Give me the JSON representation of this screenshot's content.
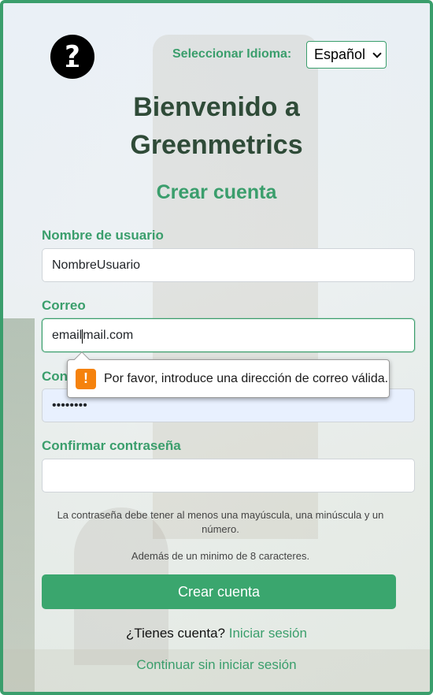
{
  "language": {
    "label": "Seleccionar Idioma:",
    "selected": "Español"
  },
  "header": {
    "title_line1": "Bienvenido a",
    "title_line2": "Greenmetrics",
    "subtitle": "Crear cuenta"
  },
  "form": {
    "username": {
      "label": "Nombre de usuario",
      "value": "NombreUsuario"
    },
    "email": {
      "label": "Correo",
      "value_before_caret": "email",
      "value_after_caret": "mail.com"
    },
    "password": {
      "label": "Con",
      "value": "••••••••"
    },
    "confirm": {
      "label": "Confirmar contraseña",
      "value": ""
    },
    "validation_message": "Por favor, introduce una dirección de correo válida.",
    "hint_line1": "La contraseña debe tener al menos una mayúscula, una minúscula y un",
    "hint_line2": "número.",
    "hint_line3": "Además de un minimo de 8 caracteres.",
    "submit_label": "Crear cuenta"
  },
  "footer": {
    "have_account": "¿Tienes cuenta?",
    "login_link": "Iniciar sesión",
    "guest_link": "Continuar sin iniciar sesión"
  },
  "colors": {
    "accent": "#3a9e6c",
    "title": "#2f4b38",
    "warning": "#f5820d"
  },
  "icons": {
    "help": "question-mark-icon",
    "warning": "warning-icon",
    "dropdown": "chevron-down-icon"
  }
}
